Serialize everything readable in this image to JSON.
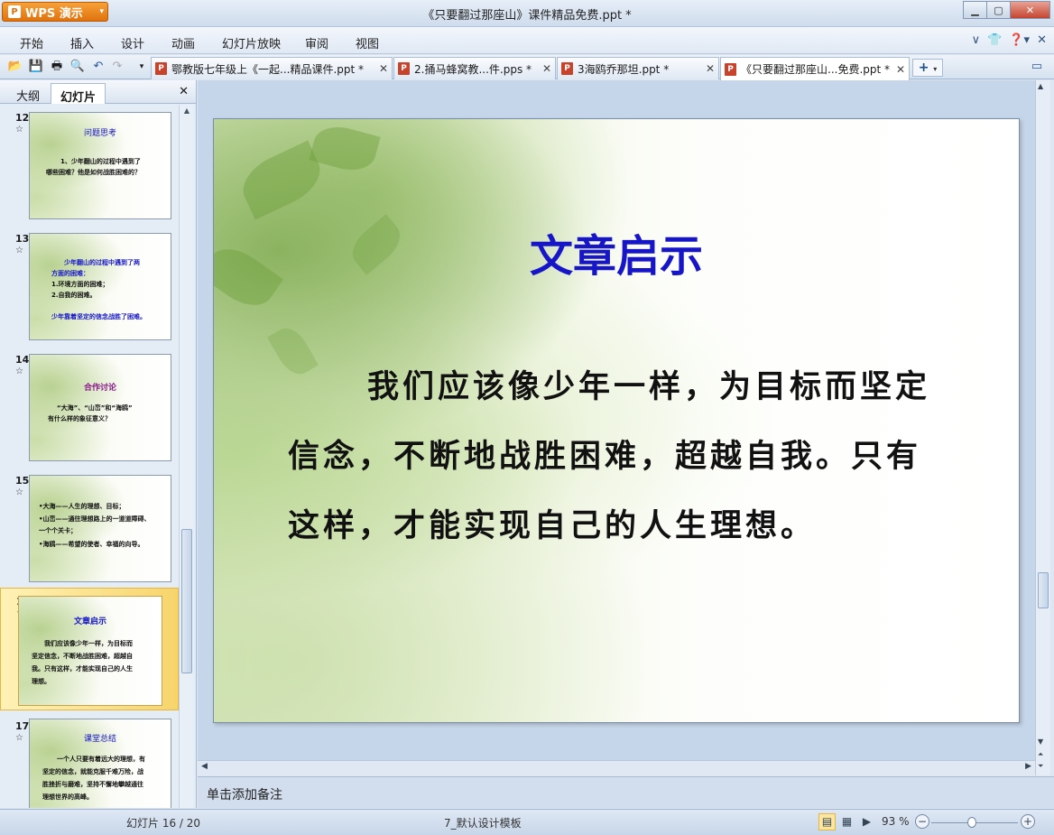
{
  "app": {
    "brand": "WPS 演示",
    "window_title": "《只要翻过那座山》课件精品免费.ppt *"
  },
  "menu": [
    "开始",
    "插入",
    "设计",
    "动画",
    "幻灯片放映",
    "审阅",
    "视图"
  ],
  "doc_tabs": [
    {
      "label": "鄂教版七年级上《一起...精品课件.ppt *",
      "active": false
    },
    {
      "label": "2.捅马蜂窝教...件.pps *",
      "active": false
    },
    {
      "label": "3海鸥乔那坦.ppt *",
      "active": false
    },
    {
      "label": "《只要翻过那座山...免费.ppt *",
      "active": true
    }
  ],
  "left_pane": {
    "tabs": [
      "大纲",
      "幻灯片"
    ],
    "active_tab": "幻灯片",
    "slides": [
      {
        "num": "12",
        "title": "问题思考",
        "lines": [
          "1、少年翻山的过程中遇到了",
          "哪些困难？他是如何战胜困难的？"
        ]
      },
      {
        "num": "13",
        "title": "",
        "lines": [
          "少年翻山的过程中遇到了两",
          "方面的困难：",
          "1.环境方面的困难；",
          "2.自我的困难。",
          "少年靠着坚定的信念战胜了困难。"
        ]
      },
      {
        "num": "14",
        "title": "合作讨论",
        "lines": [
          "“大海”、“山峦”和“海鸥”",
          "有什么样的象征意义？"
        ]
      },
      {
        "num": "15",
        "title": "",
        "lines": [
          "•大海——人生的理想、目标；",
          "•山峦——通往理想路上的一道道障碍、",
          "一个个关卡；",
          "•海鸥——希望的使者、幸福的向导。"
        ]
      },
      {
        "num": "16",
        "title": "文章启示",
        "lines": [
          "我们应该像少年一样，为目标而",
          "坚定信念，不断地战胜困难，超越自",
          "我。只有这样，才能实现自己的人生",
          "理想。"
        ],
        "selected": true
      },
      {
        "num": "17",
        "title": "课堂总结",
        "lines": [
          "一个人只要有着远大的理想，有",
          "坚定的信念，就能克服千难万险，战",
          "胜挫折与磨难，坚持不懈地攀越通往",
          "理想世界的高峰。"
        ]
      }
    ]
  },
  "slide": {
    "title": "文章启示",
    "body": "我们应该像少年一样，为目标而坚定信念，不断地战胜困难，超越自我。只有这样，才能实现自己的人生理想。"
  },
  "notes": {
    "placeholder": "单击添加备注"
  },
  "status": {
    "slide_position": "幻灯片 16 / 20",
    "template": "7_默认设计模板",
    "zoom": "93 %"
  }
}
